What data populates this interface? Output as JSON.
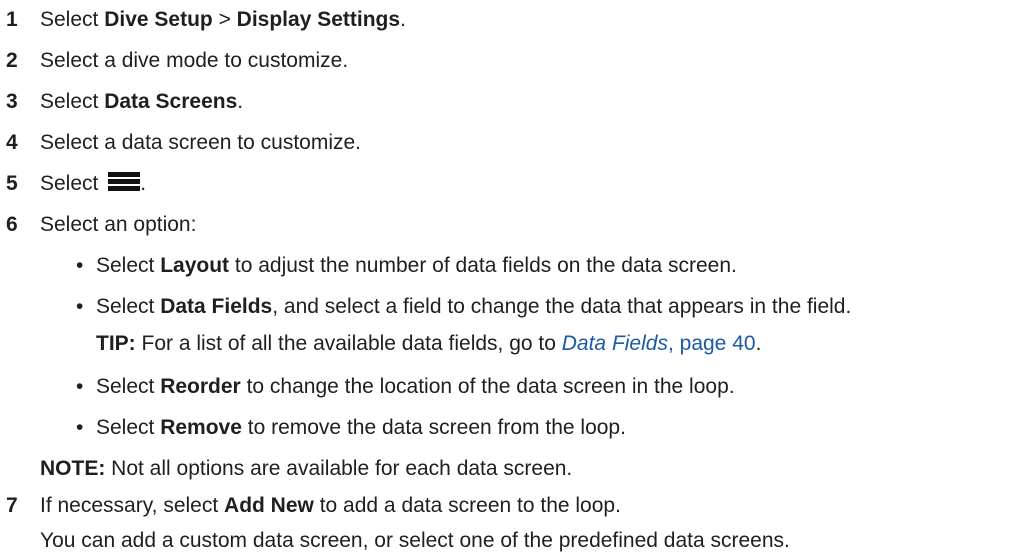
{
  "steps": [
    {
      "num": "1",
      "pre": "Select ",
      "b1": "Dive Setup",
      "mid": " > ",
      "b2": "Display Settings",
      "post": "."
    },
    {
      "num": "2",
      "text": "Select a dive mode to customize."
    },
    {
      "num": "3",
      "pre": "Select ",
      "b1": "Data Screens",
      "post": "."
    },
    {
      "num": "4",
      "text": "Select a data screen to customize."
    },
    {
      "num": "5",
      "pre": "Select ",
      "post": "."
    },
    {
      "num": "6",
      "text": "Select an option:"
    },
    {
      "num": "7",
      "pre": "If necessary, select ",
      "b1": "Add New",
      "post": " to add a data screen to the loop."
    }
  ],
  "options": [
    {
      "pre": "Select ",
      "b": "Layout",
      "post": " to adjust the number of data fields on the data screen."
    },
    {
      "pre": "Select ",
      "b": "Data Fields",
      "post": ", and select a field to change the data that appears in the field."
    },
    {
      "pre": "Select ",
      "b": "Reorder",
      "post": " to change the location of the data screen in the loop."
    },
    {
      "pre": "Select ",
      "b": "Remove",
      "post": " to remove the data screen from the loop."
    }
  ],
  "tip": {
    "label": "TIP:",
    "text": " For a list of all the available data fields, go to ",
    "link1": "Data Fields",
    "link2": ", page 40",
    "post": "."
  },
  "note": {
    "label": "NOTE:",
    "text": " Not all options are available for each data screen."
  },
  "step7_detail": "You can add a custom data screen, or select one of the predefined data screens.",
  "bullet_char": "•",
  "icons": {
    "menu": "menu-bars-icon"
  }
}
